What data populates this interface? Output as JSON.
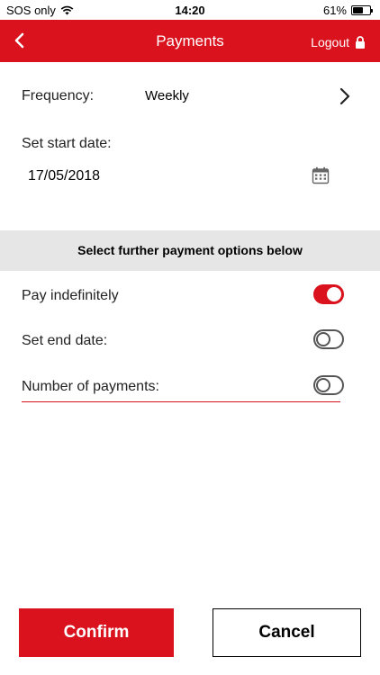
{
  "status_bar": {
    "carrier": "SOS only",
    "time": "14:20",
    "battery_text": "61%",
    "battery_level": 0.61
  },
  "nav": {
    "title": "Payments",
    "logout_label": "Logout"
  },
  "form": {
    "frequency_label": "Frequency:",
    "frequency_value": "Weekly",
    "start_date_label": "Set start date:",
    "start_date_value": "17/05/2018"
  },
  "options": {
    "banner": "Select further payment options below",
    "items": [
      {
        "label": "Pay indefinitely",
        "on": true
      },
      {
        "label": "Set end date:",
        "on": false
      },
      {
        "label": "Number of payments:",
        "on": false
      }
    ]
  },
  "buttons": {
    "confirm_label": "Confirm",
    "cancel_label": "Cancel"
  },
  "colors": {
    "accent": "#d9121d",
    "banner_bg": "#e6e6e6"
  }
}
